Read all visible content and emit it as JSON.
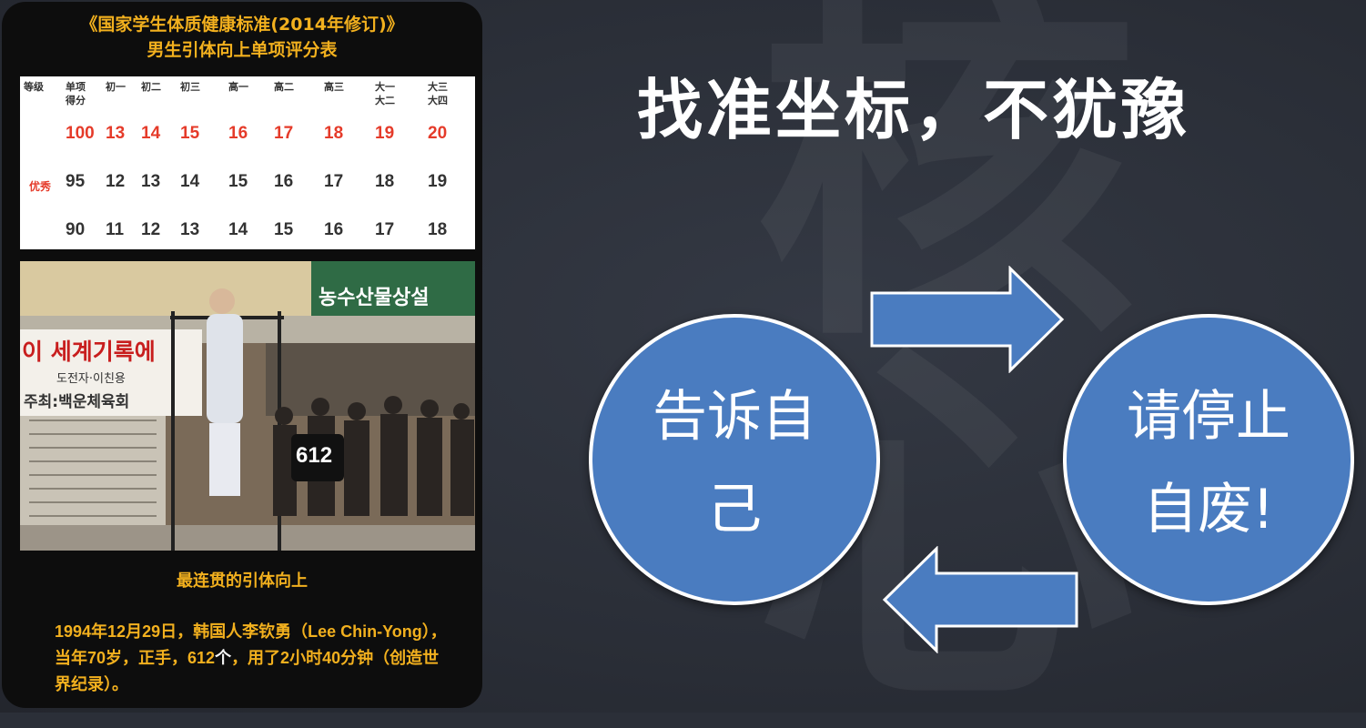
{
  "left_card": {
    "title_line1": "《国家学生体质健康标准(2014年修订)》",
    "title_line2": "男生引体向上单项评分表",
    "table": {
      "headers": [
        "等级",
        "单项\n得分",
        "初一",
        "初二",
        "初三",
        "高一",
        "高二",
        "高三",
        "大一\n大二",
        "大三\n大四"
      ],
      "grade_label": "优秀",
      "rows": [
        [
          "100",
          "13",
          "14",
          "15",
          "16",
          "17",
          "18",
          "19",
          "20"
        ],
        [
          "95",
          "12",
          "13",
          "14",
          "15",
          "16",
          "17",
          "18",
          "19"
        ],
        [
          "90",
          "11",
          "12",
          "13",
          "14",
          "15",
          "16",
          "17",
          "18"
        ]
      ]
    },
    "photo": {
      "sign_top": "농수산물상설",
      "banner_main": "이 세계기록에",
      "banner_sub1": "도전자·이친용",
      "banner_sub2": "주최:백운체육회",
      "bib_number": "612"
    },
    "caption": "最连贯的引体向上",
    "description_part1": "1994年12月29日，韩国人李钦勇（Lee Chin-Yong），当年70岁，正手，612",
    "description_part2": "个",
    "description_part3": "，用了2小时40分钟（创造世界纪录）。"
  },
  "main": {
    "headline": "找准坐标，不犹豫",
    "circle_left_line1": "告诉自",
    "circle_left_line2": "己",
    "circle_right_line1": "请停止",
    "circle_right_line2": "自废!",
    "watermark": "核心"
  },
  "colors": {
    "background": "#2b2f38",
    "circle_fill": "#4a7cc0",
    "accent_gold": "#f2b01e",
    "accent_red": "#e53b2a"
  }
}
